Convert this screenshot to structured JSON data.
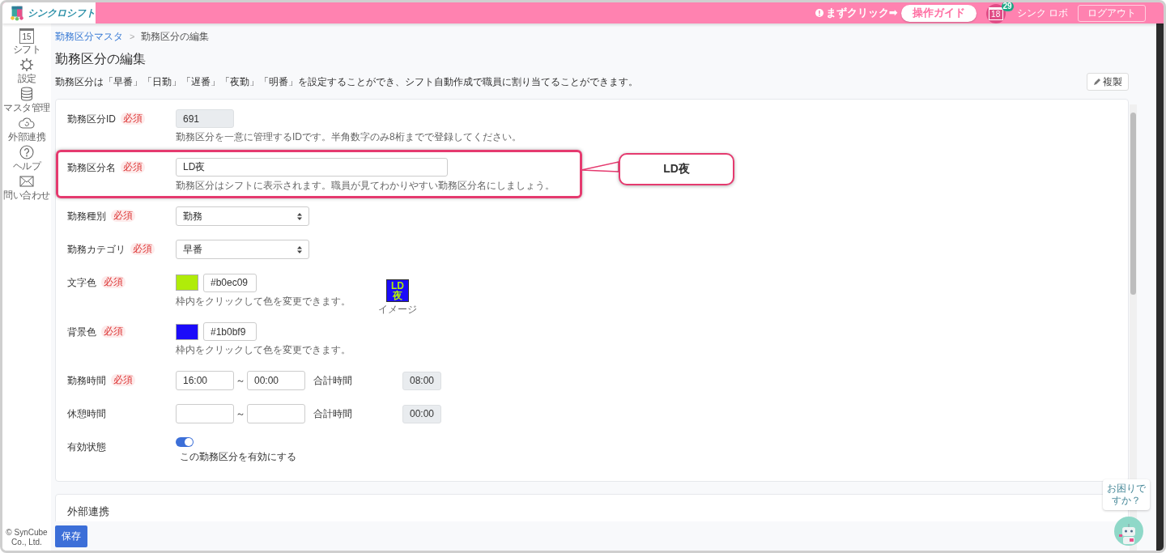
{
  "header": {
    "logo_text": "シンクロシフト",
    "notice": "まずクリック➡",
    "guide_button": "操作ガイド",
    "calendar_day": "18",
    "calendar_badge": "29",
    "robot_link": "シンク ロボ",
    "logout_button": "ログアウト"
  },
  "sidebar": {
    "items": [
      {
        "kind": "calendar",
        "label": "シフト",
        "day": "15"
      },
      {
        "kind": "gear",
        "label": "設定"
      },
      {
        "kind": "database",
        "label": "マスタ管理"
      },
      {
        "kind": "cloud",
        "label": "外部連携"
      },
      {
        "kind": "help",
        "label": "ヘルプ"
      },
      {
        "kind": "mail",
        "label": "問い合わせ"
      }
    ],
    "copyright": "© SynCube Co., Ltd."
  },
  "breadcrumb": [
    {
      "label": "勤務区分マスタ",
      "link": true
    },
    {
      "label": "勤務区分の編集",
      "link": false,
      "separator": ">"
    }
  ],
  "page_title": "勤務区分の編集",
  "description": "勤務区分は「早番」「日勤」「遅番」「夜勤」「明番」を設定することができ、シフト自動作成で職員に割り当てることができます。",
  "copy_button": "複製",
  "form": {
    "rows": [
      {
        "kind": "readonly",
        "label": "勤務区分ID",
        "required": "必須",
        "value": "691",
        "hint": "勤務区分を一意に管理するIDです。半角数字のみ8桁までで登録してください。"
      },
      {
        "kind": "text",
        "label": "勤務区分名",
        "required": "必須",
        "value": "LD夜",
        "hint": "勤務区分はシフトに表示されます。職員が見てわかりやすい勤務区分名にしましょう。",
        "highlighted": true,
        "callout": "LD夜"
      },
      {
        "kind": "select",
        "label": "勤務種別",
        "required": "必須",
        "value": "勤務"
      },
      {
        "kind": "select",
        "label": "勤務カテゴリ",
        "required": "必須",
        "value": "早番"
      },
      {
        "kind": "color",
        "label": "文字色",
        "required": "必須",
        "value": "#b0ec09",
        "hint": "枠内をクリックして色を変更できます。",
        "preview_text": "LD夜",
        "preview_label": "イメージ"
      },
      {
        "kind": "color",
        "label": "背景色",
        "required": "必須",
        "value": "#1b0bf9",
        "hint": "枠内をクリックして色を変更できます。"
      },
      {
        "kind": "time",
        "label": "勤務時間",
        "required": "必須",
        "start": "16:00",
        "separator": "～",
        "end": "00:00",
        "total_label": "合計時間",
        "total": "08:00"
      },
      {
        "kind": "time",
        "label": "休憩時間",
        "separator": "～",
        "total_label": "合計時間",
        "total": "00:00"
      },
      {
        "kind": "toggle",
        "label": "有効状態",
        "on": true,
        "toggle_label": "この勤務区分を有効にする"
      }
    ]
  },
  "section2_title": "外部連携",
  "save_button": "保存",
  "help_bubble": "お困りですか？"
}
